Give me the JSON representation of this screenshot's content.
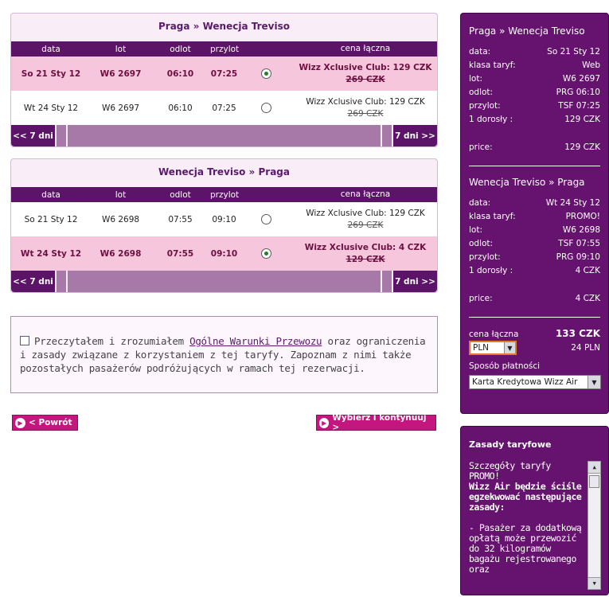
{
  "outbound": {
    "title": "Praga » Wenecja Treviso",
    "headers": {
      "date": "data",
      "flight": "lot",
      "departure": "odlot",
      "arrival": "przylot",
      "price": "cena łączna"
    },
    "rows": [
      {
        "date": "So 21 Sty 12",
        "flight": "W6 2697",
        "departure": "06:10",
        "arrival": "07:25",
        "price": "Wizz Xclusive Club: 129 CZK",
        "old_price": "269 CZK",
        "selected": true
      },
      {
        "date": "Wt 24 Sty 12",
        "flight": "W6 2697",
        "departure": "06:10",
        "arrival": "07:25",
        "price": "Wizz Xclusive Club: 129 CZK",
        "old_price": "269 CZK",
        "selected": false
      }
    ],
    "prev_label": "<< 7 dni",
    "next_label": "7 dni >>"
  },
  "return": {
    "title": "Wenecja Treviso » Praga",
    "headers": {
      "date": "data",
      "flight": "lot",
      "departure": "odlot",
      "arrival": "przylot",
      "price": "cena łączna"
    },
    "rows": [
      {
        "date": "So 21 Sty 12",
        "flight": "W6 2698",
        "departure": "07:55",
        "arrival": "09:10",
        "price": "Wizz Xclusive Club: 129 CZK",
        "old_price": "269 CZK",
        "selected": false
      },
      {
        "date": "Wt 24 Sty 12",
        "flight": "W6 2698",
        "departure": "07:55",
        "arrival": "09:10",
        "price": "Wizz Xclusive Club: 4 CZK",
        "old_price": "129 CZK",
        "selected": true
      }
    ],
    "prev_label": "<< 7 dni",
    "next_label": "7 dni >>"
  },
  "terms": {
    "text_before": "Przeczytałem i zrozumiałem ",
    "link": "Ogólne Warunki Przewozu",
    "text_after": " oraz ograniczenia i zasady związane z korzystaniem z tej taryfy. Zapoznam z nimi także pozostałych pasażerów podróżujących w ramach tej rezerwacji.",
    "checked": false
  },
  "buttons": {
    "back": "< Powrót",
    "continue": "Wybierz i kontynuuj >"
  },
  "summary": {
    "legs": [
      {
        "route": "Praga » Wenecja Treviso",
        "fields": [
          {
            "label": "data:",
            "value": "So 21 Sty 12"
          },
          {
            "label": "klasa taryf:",
            "value": "Web"
          },
          {
            "label": "lot:",
            "value": "W6 2697"
          },
          {
            "label": "odlot:",
            "value": "PRG 06:10"
          },
          {
            "label": "przylot:",
            "value": "TSF 07:25"
          },
          {
            "label": "1 dorosły :",
            "value": "129 CZK"
          }
        ],
        "price_label": "price:",
        "price": "129 CZK"
      },
      {
        "route": "Wenecja Treviso » Praga",
        "fields": [
          {
            "label": "data:",
            "value": "Wt 24 Sty 12"
          },
          {
            "label": "klasa taryf:",
            "value": "PROMO!"
          },
          {
            "label": "lot:",
            "value": "W6 2698"
          },
          {
            "label": "odlot:",
            "value": "TSF 07:55"
          },
          {
            "label": "przylot:",
            "value": "PRG 09:10"
          },
          {
            "label": "1 dorosły :",
            "value": "4 CZK"
          }
        ],
        "price_label": "price:",
        "price": "4 CZK"
      }
    ],
    "total_label": "cena łączna",
    "total": "133 CZK",
    "currency": "PLN",
    "total_converted": "24 PLN",
    "payment_label": "Sposób płatności",
    "payment_method": "Karta Kredytowa Wizz Air"
  },
  "rules": {
    "title": "Zasady taryfowe",
    "line1": "Szczegóły taryfy PROMO!",
    "bold": "Wizz Air będzie ściśle egzekwować następujące zasady:",
    "body": "- Pasażer za dodatkową opłatą może przewozić do 32 kilogramów bagażu rejestrowanego oraz"
  },
  "colors": {
    "brand_purple": "#5c1469",
    "accent_pink": "#c4167e",
    "selected_row": "#f5c6dc"
  }
}
